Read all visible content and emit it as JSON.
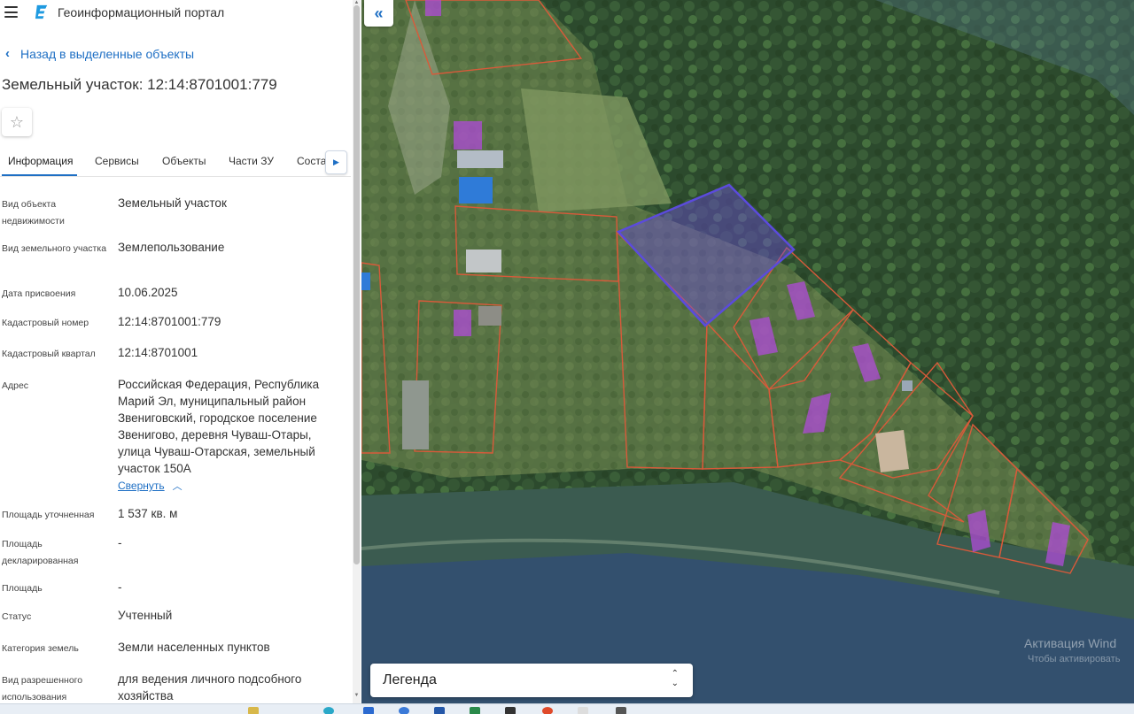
{
  "app": {
    "title": "Геоинформационный портал"
  },
  "panel": {
    "back_label": "Назад в выделенные объекты",
    "title": "Земельный участок: 12:14:8701001:779",
    "tabs": [
      {
        "label": "Информация",
        "active": true
      },
      {
        "label": "Сервисы",
        "active": false
      },
      {
        "label": "Объекты",
        "active": false
      },
      {
        "label": "Части ЗУ",
        "active": false
      },
      {
        "label": "Соста",
        "active": false
      }
    ],
    "rows": {
      "object_type": {
        "label": "Вид объекта недвижимости",
        "value": "Земельный участок"
      },
      "land_type": {
        "label": "Вид земельного участка",
        "value": "Землепользование"
      },
      "assign_date": {
        "label": "Дата присвоения",
        "value": "10.06.2025"
      },
      "cadastral_number": {
        "label": "Кадастровый номер",
        "value": "12:14:8701001:779"
      },
      "cadastral_quarter": {
        "label": "Кадастровый квартал",
        "value": "12:14:8701001"
      },
      "address": {
        "label": "Адрес",
        "value": "Российская Федерация, Республика Марий Эл, муниципальный район Звениговский, городское поселение Звенигово, деревня Чуваш-Отары, улица Чуваш-Отарская, земельный участок 150А"
      },
      "area_specified": {
        "label": "Площадь уточненная",
        "value": "1 537 кв. м"
      },
      "area_declared": {
        "label": "Площадь декларированная",
        "value": "-"
      },
      "area": {
        "label": "Площадь",
        "value": "-"
      },
      "status": {
        "label": "Статус",
        "value": "Учтенный"
      },
      "land_category": {
        "label": "Категория земель",
        "value": "Земли населенных пунктов"
      },
      "permitted_use": {
        "label": "Вид разрешенного использования",
        "value": "для ведения личного подсобного хозяйства"
      }
    },
    "collapse_label": "Свернуть"
  },
  "map": {
    "legend_label": "Легенда",
    "watermark_line1": "Активация Wind",
    "watermark_line2": "Чтобы активировать"
  },
  "colors": {
    "accent": "#1e6fc4",
    "parcel_border": "#d85a3a",
    "selected_parcel": "#5b4bdc",
    "building_fill": "#b04bd8"
  }
}
